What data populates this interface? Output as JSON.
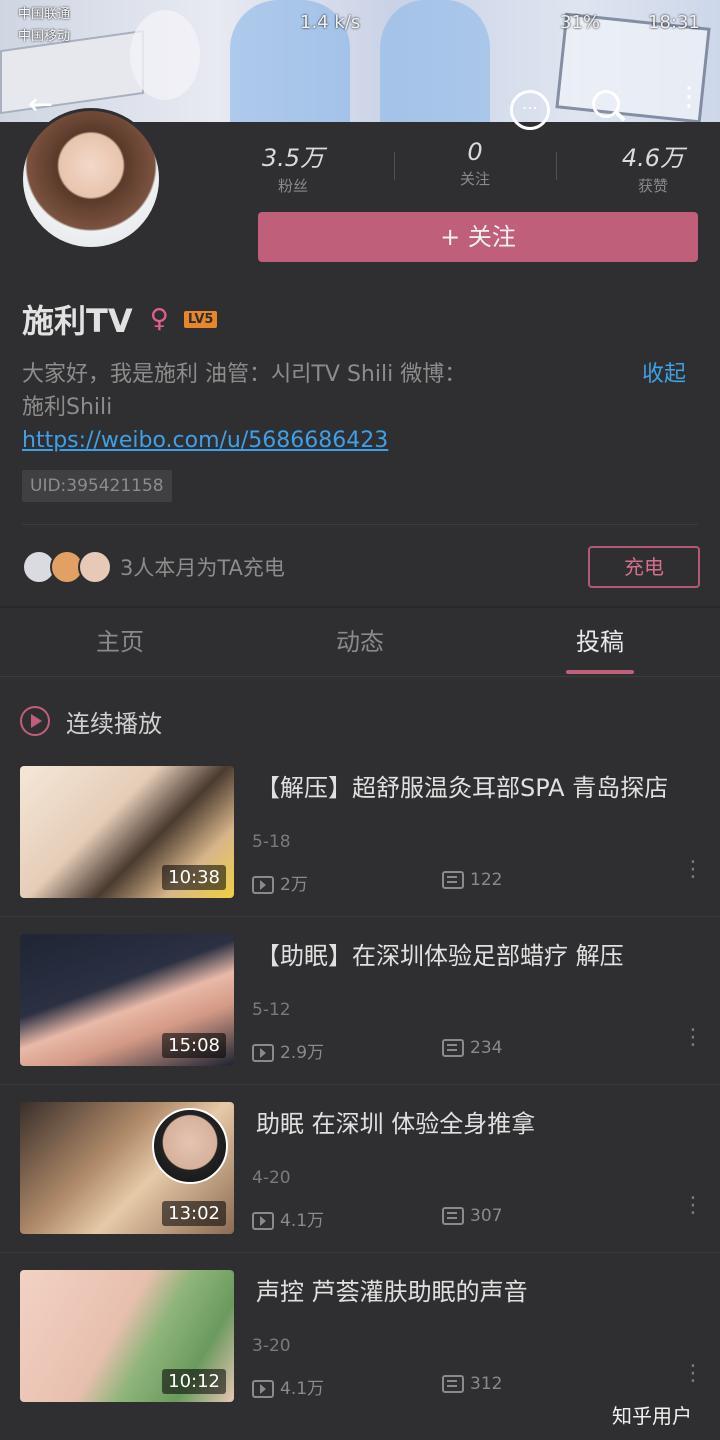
{
  "status_bar": {
    "carrier1": "中国联通",
    "carrier2": "中国移动",
    "speed": "1.4 k/s",
    "battery": "31%",
    "time": "18:31"
  },
  "nav": {
    "back_icon": "arrow-left-icon",
    "more_icon": "ellipsis-circle-icon",
    "search_icon": "search-icon",
    "menu_icon": "vertical-dots-icon"
  },
  "profile": {
    "stats": [
      {
        "value": "3.5万",
        "label": "粉丝"
      },
      {
        "value": "0",
        "label": "关注"
      },
      {
        "value": "4.6万",
        "label": "获赞"
      }
    ],
    "follow_label": "+ 关注",
    "name": "施利TV",
    "gender_symbol": "♀",
    "level": "LV5",
    "bio_line1": "大家好，我是施利 油管：시리TV Shili 微博：",
    "bio_line2": "施利Shili",
    "collapse_label": "收起",
    "bio_url": "https://weibo.com/u/5686686423",
    "uid": "UID:395421158",
    "charge_text": "3人本月为TA充电",
    "charge_button": "充电"
  },
  "tabs": [
    {
      "label": "主页",
      "active": false
    },
    {
      "label": "动态",
      "active": false
    },
    {
      "label": "投稿",
      "active": true
    }
  ],
  "autoplay_label": "连续播放",
  "videos": [
    {
      "title": "【解压】超舒服温灸耳部SPA 青岛探店",
      "date": "5-18",
      "duration": "10:38",
      "views": "2万",
      "danmaku": "122"
    },
    {
      "title": "【助眠】在深圳体验足部蜡疗 解压",
      "date": "5-12",
      "duration": "15:08",
      "views": "2.9万",
      "danmaku": "234"
    },
    {
      "title": "助眠 在深圳 体验全身推拿",
      "date": "4-20",
      "duration": "13:02",
      "views": "4.1万",
      "danmaku": "307"
    },
    {
      "title": "声控 芦荟灌肤助眠的声音",
      "date": "3-20",
      "duration": "10:12",
      "views": "4.1万",
      "danmaku": "312"
    }
  ],
  "watermark": "知乎用户",
  "colors": {
    "accent": "#c05f79",
    "link": "#3ea0e6",
    "background": "#2f2f31"
  }
}
